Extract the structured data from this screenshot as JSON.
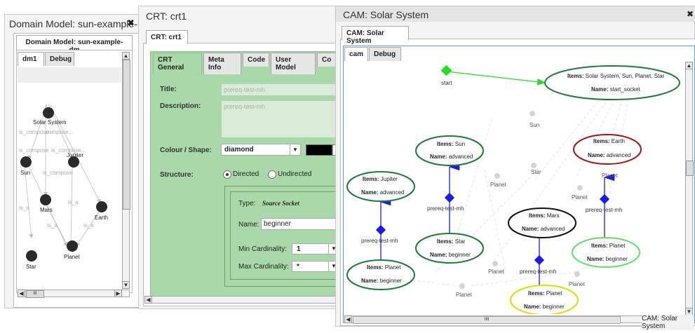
{
  "left_window": {
    "title": "Domain Model: sun-example-",
    "close": "✖",
    "tab": "Domain Model: sun-example-dm",
    "subtabs": [
      "dm1",
      "Debug"
    ],
    "nodes": {
      "solar_system": "Solar System",
      "sun": "Sun",
      "jupiter": "Jupiter",
      "mars": "Mars",
      "earth": "Earth",
      "planet": "Planet",
      "star": "Star"
    },
    "edges": {
      "e1": "is_compose",
      "e2": "compose...",
      "e3": "is_compose",
      "e4": "is_compose...",
      "e5": "is_compose",
      "e6": "is_a",
      "e7": "is_a",
      "e8": "is_a",
      "e9": "is_a"
    },
    "hscroll_label": "III"
  },
  "crt_window": {
    "title": "CRT: crt1",
    "tab": "CRT: crt1",
    "subtabs": [
      "CRT General",
      "Meta Info",
      "Code",
      "User Model",
      "Co"
    ],
    "title_label": "Title:",
    "title_value": "prereq-test-mh",
    "description_label": "Description:",
    "description_value": "prereq-test-mh",
    "colour_label": "Colour / Shape:",
    "shape_value": "diamond",
    "colour_value": "#000000",
    "structure_label": "Structure:",
    "directed": "Directed",
    "undirected": "Undirected",
    "type_label": "Type:",
    "type_value": "Source Socket",
    "name_label": "Name:",
    "name_value": "beginner",
    "min_card_label": "Min Cardinality:",
    "min_card_value": "1",
    "max_card_label": "Max Cardinality:",
    "max_card_value": "*"
  },
  "cam_window": {
    "title": "CAM: Solar System",
    "close": "✖",
    "tab": "CAM: Solar System",
    "subtabs": [
      "cam",
      "Debug"
    ],
    "start": "start",
    "items_label": "Items:",
    "name_label": "Name:",
    "sockets": {
      "start_socket": {
        "items": "Solar System, Sun, Planet, Star",
        "name": "start_socket",
        "border": "#1f7a3a"
      },
      "sun_adv": {
        "items": "Sun",
        "name": "advanced",
        "border": "#1f7a3a"
      },
      "earth_adv": {
        "items": "Earth",
        "name": "advanced",
        "border": "#a01818"
      },
      "jupiter_adv": {
        "items": "Jupiter",
        "name": "advanced",
        "border": "#1f7a3a"
      },
      "mars_adv": {
        "items": "Mars",
        "name": "advanced",
        "border": "#111111"
      },
      "star_beg": {
        "items": "Star",
        "name": "beginner",
        "border": "#1f7a3a"
      },
      "planet_beg_green": {
        "items": "Planet",
        "name": "beginner",
        "border": "#66dd66"
      },
      "planet_beg_left": {
        "items": "Planet",
        "name": "beginner",
        "border": "#1f7a3a"
      },
      "planet_beg_yellow": {
        "items": "Planet",
        "name": "beginner",
        "border": "#e6d800"
      }
    },
    "relation_label": "prereq-test-mh",
    "ghost": {
      "sun": "Sun",
      "star": "Star",
      "planet": "Planet"
    },
    "status": "CAM: Solar System",
    "hscroll_label": "IIII"
  }
}
